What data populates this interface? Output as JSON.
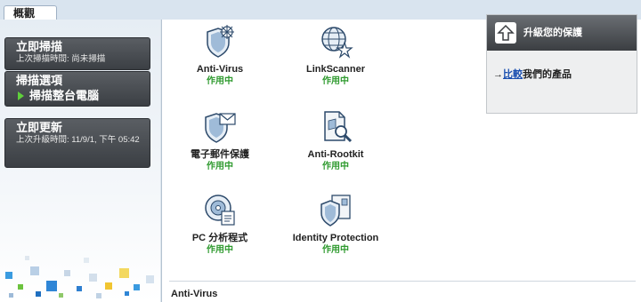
{
  "tab": {
    "label": "概觀"
  },
  "sidebar": {
    "scan_now": {
      "title": "立即掃描",
      "subtitle": "上次掃描時間: 尚未掃描"
    },
    "scan_options": {
      "title": "掃描選項",
      "action": "掃描整台電腦"
    },
    "update_now": {
      "title": "立即更新",
      "subtitle": "上次升級時間: 11/9/1, 下午 05:42"
    }
  },
  "features": [
    {
      "name": "Anti-Virus",
      "status": "作用中",
      "icon": "shield-virus-icon"
    },
    {
      "name": "LinkScanner",
      "status": "作用中",
      "icon": "globe-link-icon"
    },
    {
      "name": "電子郵件保護",
      "status": "作用中",
      "icon": "shield-mail-icon"
    },
    {
      "name": "Anti-Rootkit",
      "status": "作用中",
      "icon": "document-magnifier-icon"
    },
    {
      "name": "PC 分析程式",
      "status": "作用中",
      "icon": "disc-analyzer-icon"
    },
    {
      "name": "Identity Protection",
      "status": "作用中",
      "icon": "shield-id-icon"
    }
  ],
  "upgrade": {
    "title": "升級您的保護",
    "link_label": "比較",
    "link_suffix": "我們的產品"
  },
  "detail": {
    "title": "Anti-Virus"
  },
  "colors": {
    "status_green": "#2e9a2e",
    "link_blue": "#1a4fb0",
    "panel_dark": "#3b3f44"
  }
}
